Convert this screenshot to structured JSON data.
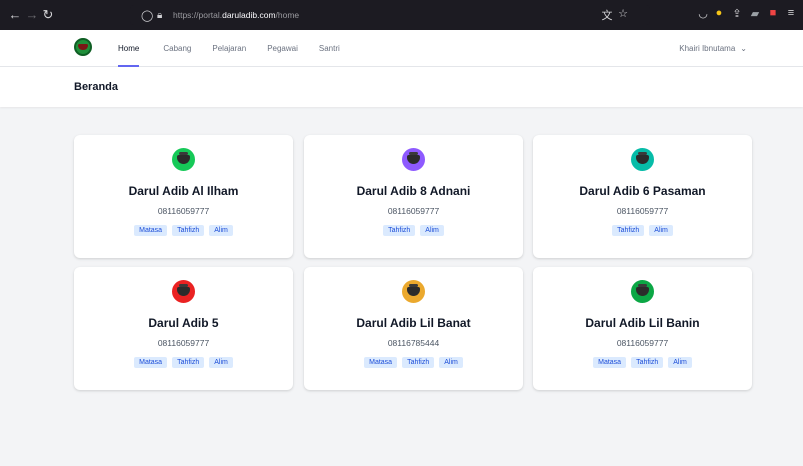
{
  "browser": {
    "url_prefix": "https://portal.",
    "url_domain": "daruladib.com",
    "url_path": "/home"
  },
  "header": {
    "nav": [
      {
        "label": "Home",
        "active": true
      },
      {
        "label": "Cabang",
        "active": false
      },
      {
        "label": "Pelajaran",
        "active": false
      },
      {
        "label": "Pegawai",
        "active": false
      },
      {
        "label": "Santri",
        "active": false
      }
    ],
    "user_name": "Khairi Ibnutama"
  },
  "page": {
    "title": "Beranda"
  },
  "branches": [
    {
      "name": "Darul Adib Al Ilham",
      "phone": "08116059777",
      "tags": [
        "Matasa",
        "Tahfizh",
        "Alim"
      ],
      "logo_color": "#22c55e"
    },
    {
      "name": "Darul Adib 8 Adnani",
      "phone": "08116059777",
      "tags": [
        "Tahfizh",
        "Alim"
      ],
      "logo_color": "#8b5cf6"
    },
    {
      "name": "Darul Adib 6 Pasaman",
      "phone": "08116059777",
      "tags": [
        "Tahfizh",
        "Alim"
      ],
      "logo_color": "#14b8a6"
    },
    {
      "name": "Darul Adib 5",
      "phone": "08116059777",
      "tags": [
        "Matasa",
        "Tahfizh",
        "Alim"
      ],
      "logo_color": "#dc2626"
    },
    {
      "name": "Darul Adib Lil Banat",
      "phone": "08116785444",
      "tags": [
        "Matasa",
        "Tahfizh",
        "Alim"
      ],
      "logo_color": "#e5a93a"
    },
    {
      "name": "Darul Adib Lil Banin",
      "phone": "08116059777",
      "tags": [
        "Matasa",
        "Tahfizh",
        "Alim"
      ],
      "logo_color": "#16a34a"
    }
  ]
}
